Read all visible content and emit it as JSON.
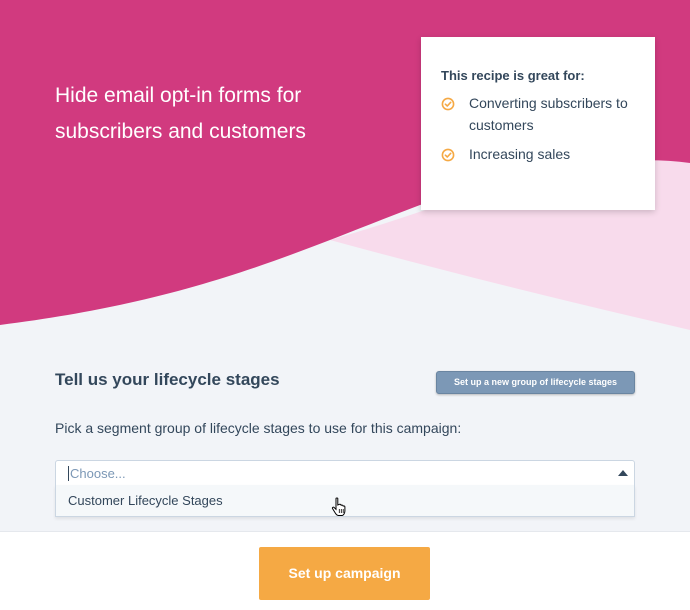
{
  "hero": {
    "title": "Hide email opt-in forms for subscribers and customers"
  },
  "recipe_card": {
    "title": "This recipe is great for:",
    "benefits": [
      {
        "label": "Converting subscribers to customers",
        "icon": "check-circle-icon"
      },
      {
        "label": "Increasing sales",
        "icon": "check-circle-icon"
      }
    ]
  },
  "lifecycle": {
    "title": "Tell us your lifecycle stages",
    "new_group_button": "Set up a new group of lifecycle stages",
    "instruction": "Pick a segment group of lifecycle stages to use for this campaign:",
    "select": {
      "placeholder": "Choose...",
      "options": [
        "Customer Lifecycle Stages"
      ]
    }
  },
  "footer": {
    "setup_button": "Set up campaign"
  },
  "colors": {
    "hero_magenta": "#d13a7f",
    "hero_light_pink": "#f8dbec",
    "page_background": "#f2f4f8",
    "accent_orange": "#f5a944",
    "button_slate": "#7c98b6",
    "text_dark": "#33475b"
  }
}
